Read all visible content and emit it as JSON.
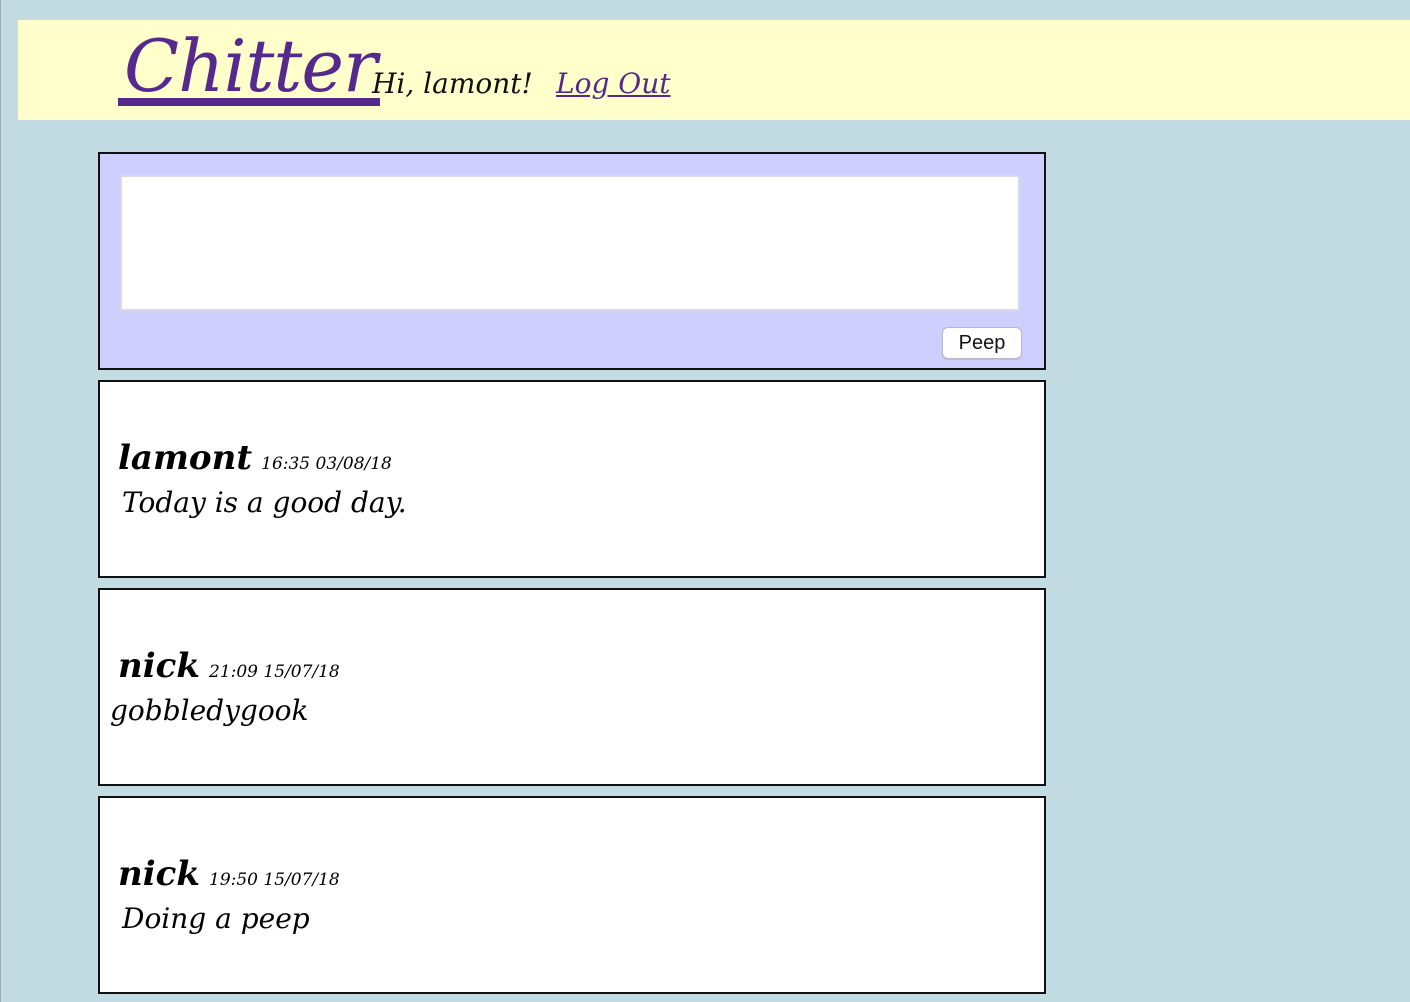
{
  "header": {
    "logo_text": "Chitter",
    "greeting": "Hi, lamont!",
    "logout_label": "Log Out"
  },
  "compose": {
    "textarea_value": "",
    "submit_label": "Peep"
  },
  "peeps": [
    {
      "author": "lamont",
      "timestamp": "16:35 03/08/18",
      "text": "Today is a good day."
    },
    {
      "author": "nick",
      "timestamp": "21:09 15/07/18",
      "text": "gobbledygook"
    },
    {
      "author": "nick",
      "timestamp": "19:50 15/07/18",
      "text": "Doing a peep"
    }
  ],
  "colors": {
    "page_background": "#c3dce3",
    "header_background": "#ffffcc",
    "compose_background": "#ceceff",
    "accent": "#552a8c"
  }
}
